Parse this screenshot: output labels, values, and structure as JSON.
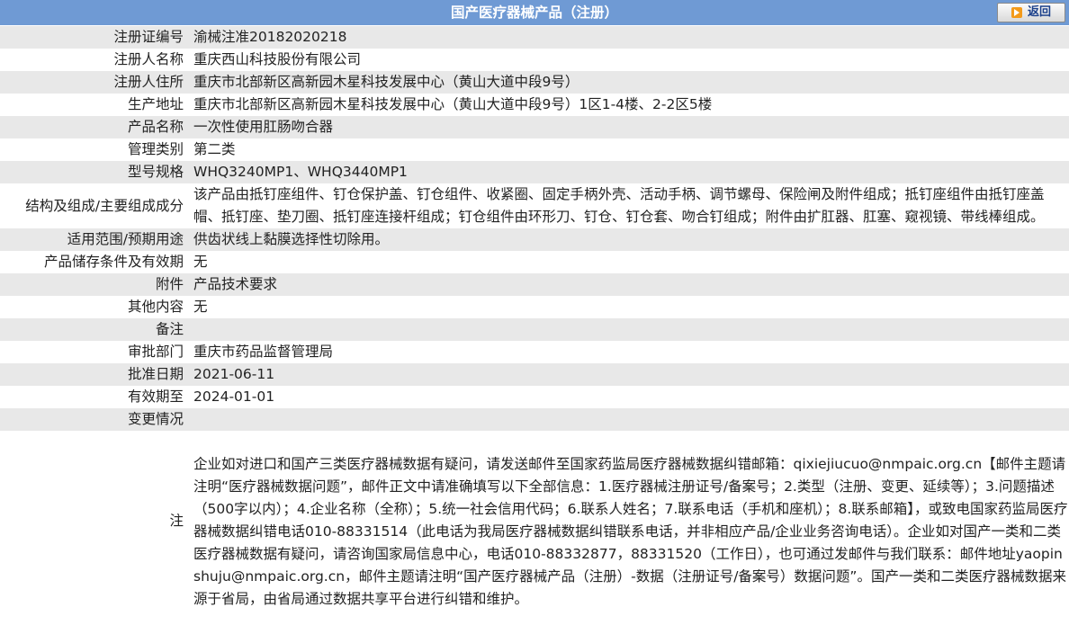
{
  "header": {
    "title": "国产医疗器械产品（注册）",
    "back_label": "返回"
  },
  "rows": [
    {
      "label": "注册证编号",
      "value": "渝械注准20182020218"
    },
    {
      "label": "注册人名称",
      "value": "重庆西山科技股份有限公司"
    },
    {
      "label": "注册人住所",
      "value": "重庆市北部新区高新园木星科技发展中心（黄山大道中段9号）"
    },
    {
      "label": "生产地址",
      "value": "重庆市北部新区高新园木星科技发展中心（黄山大道中段9号）1区1-4楼、2-2区5楼"
    },
    {
      "label": "产品名称",
      "value": "一次性使用肛肠吻合器"
    },
    {
      "label": "管理类别",
      "value": "第二类"
    },
    {
      "label": "型号规格",
      "value": "WHQ3240MP1、WHQ3440MP1"
    },
    {
      "label": "结构及组成/主要组成成分",
      "value": "该产品由抵钉座组件、钉仓保护盖、钉仓组件、收紧圈、固定手柄外壳、活动手柄、调节螺母、保险闸及附件组成；抵钉座组件由抵钉座盖帽、抵钉座、垫刀圈、抵钉座连接杆组成；钉仓组件由环形刀、钉仓、钉仓套、吻合钉组成；附件由扩肛器、肛塞、窥视镜、带线棒组成。"
    },
    {
      "label": "适用范围/预期用途",
      "value": "供齿状线上黏膜选择性切除用。"
    },
    {
      "label": "产品储存条件及有效期",
      "value": "无"
    },
    {
      "label": "附件",
      "value": "产品技术要求"
    },
    {
      "label": "其他内容",
      "value": "无"
    },
    {
      "label": "备注",
      "value": ""
    },
    {
      "label": "审批部门",
      "value": "重庆市药品监督管理局"
    },
    {
      "label": "批准日期",
      "value": "2021-06-11"
    },
    {
      "label": "有效期至",
      "value": "2024-01-01"
    },
    {
      "label": "变更情况",
      "value": ""
    }
  ],
  "note": {
    "label": "注",
    "value": "企业如对进口和国产三类医疗器械数据有疑问，请发送邮件至国家药监局医疗器械数据纠错邮箱：qixiejiucuo@nmpaic.org.cn【邮件主题请注明“医疗器械数据问题”，邮件正文中请准确填写以下全部信息：1.医疗器械注册证号/备案号；2.类型（注册、变更、延续等）；3.问题描述（500字以内）；4.企业名称（全称）；5.统一社会信用代码；6.联系人姓名；7.联系电话（手机和座机）；8.联系邮箱】，或致电国家药监局医疗器械数据纠错电话010-88331514（此电话为我局医疗器械数据纠错联系电话，并非相应产品/企业业务咨询电话）。企业如对国产一类和二类医疗器械数据有疑问，请咨询国家局信息中心，电话010-88332877，88331520（工作日），也可通过发邮件与我们联系：邮件地址yaopinshuju@nmpaic.org.cn，邮件主题请注明“国产医疗器械产品（注册）-数据（注册证号/备案号）数据问题”。国产一类和二类医疗器械数据来源于省局，由省局通过数据共享平台进行纠错和维护。"
  }
}
